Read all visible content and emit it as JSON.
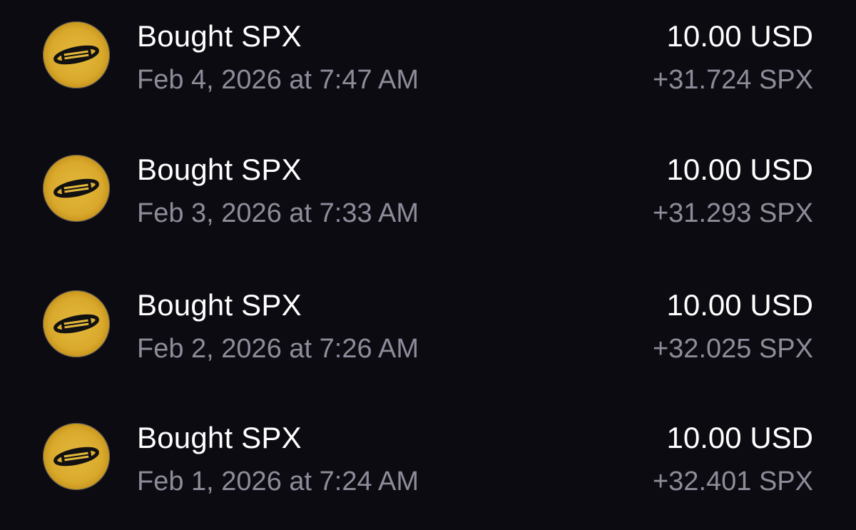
{
  "transactions": [
    {
      "title": "Bought SPX",
      "date": "Feb 4, 2026 at 7:47 AM",
      "amount": "10.00 USD",
      "quantity": "+31.724 SPX",
      "icon": "spx-coin-icon"
    },
    {
      "title": "Bought SPX",
      "date": "Feb 3, 2026 at 7:33 AM",
      "amount": "10.00 USD",
      "quantity": "+31.293 SPX",
      "icon": "spx-coin-icon"
    },
    {
      "title": "Bought SPX",
      "date": "Feb 2, 2026 at 7:26 AM",
      "amount": "10.00 USD",
      "quantity": "+32.025 SPX",
      "icon": "spx-coin-icon"
    },
    {
      "title": "Bought SPX",
      "date": "Feb 1, 2026 at 7:24 AM",
      "amount": "10.00 USD",
      "quantity": "+32.401 SPX",
      "icon": "spx-coin-icon"
    }
  ],
  "colors": {
    "background": "#0c0b12",
    "primary_text": "#ffffff",
    "secondary_text": "#8e8c99",
    "coin_gold": "#d9a92c"
  }
}
